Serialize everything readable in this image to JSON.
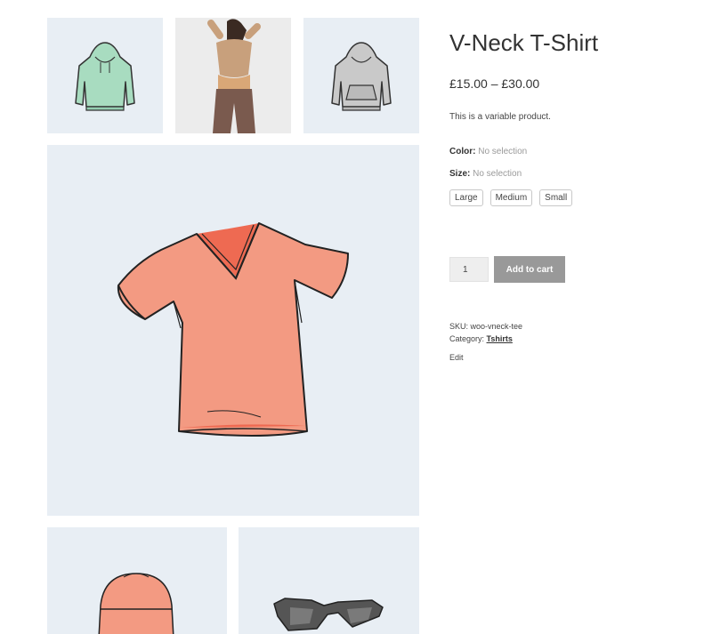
{
  "product": {
    "title": "V-Neck T-Shirt",
    "price_range": "£15.00 – £30.00",
    "description": "This is a variable product."
  },
  "attributes": {
    "color": {
      "label": "Color:",
      "value": "No selection"
    },
    "size": {
      "label": "Size:",
      "value": "No selection",
      "options": [
        "Large",
        "Medium",
        "Small"
      ]
    }
  },
  "cart": {
    "quantity": "1",
    "add_label": "Add to cart"
  },
  "meta": {
    "sku_label": "SKU:",
    "sku": "woo-vneck-tee",
    "category_label": "Category:",
    "category": "Tshirts",
    "edit_label": "Edit"
  },
  "gallery": {
    "images": [
      {
        "name": "hoodie-green",
        "color": "#a8dcc0"
      },
      {
        "name": "person-back-photo",
        "color": "#c8a07c"
      },
      {
        "name": "hoodie-gray",
        "color": "#c9c9c9"
      },
      {
        "name": "vneck-tshirt-coral",
        "color": "#f39a82"
      },
      {
        "name": "beanie-coral",
        "color": "#f39a82"
      },
      {
        "name": "sunglasses",
        "color": "#555555"
      }
    ]
  }
}
